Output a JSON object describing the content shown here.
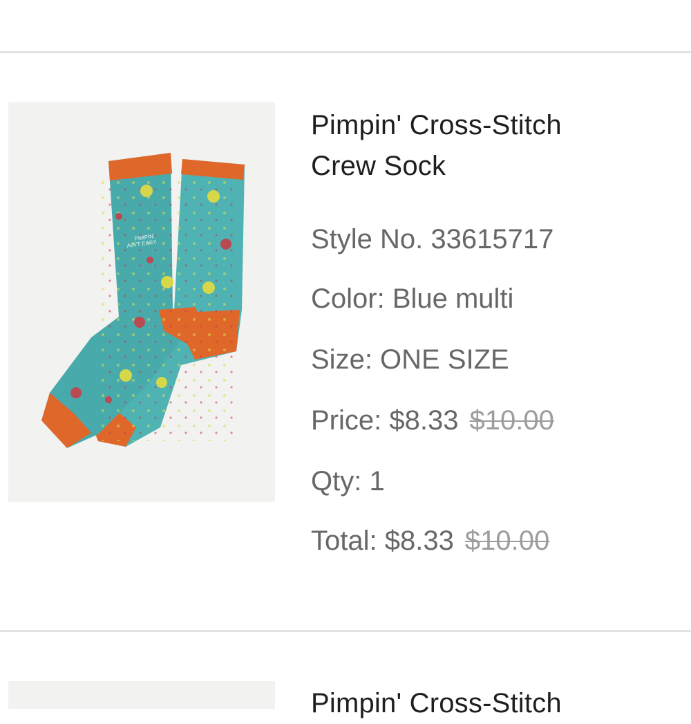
{
  "items": [
    {
      "title": "Pimpin' Cross-Stitch Crew Sock",
      "title_line1": "Pimpin' Cross-Stitch",
      "title_line2": "Crew Sock",
      "style": "Style No. 33615717",
      "color": "Color: Blue multi",
      "size": "Size: ONE SIZE",
      "price_label": "Price:",
      "price": "$8.33",
      "price_original": "$10.00",
      "qty": "Qty: 1",
      "total_label": "Total:",
      "total": "$8.33",
      "total_original": "$10.00",
      "image_text": "PIMPIN' AIN'T EASY"
    },
    {
      "title_partial": "Pimpin' Cross-Stitch"
    }
  ],
  "colors": {
    "sock_teal": "#4fb3b4",
    "sock_orange": "#e0672a",
    "text_dark": "#1f1f1f",
    "text_gray": "#676767",
    "strike_gray": "#9d9d9d",
    "divider": "#e2e2e2"
  },
  "icons": [
    "sock-illustration"
  ]
}
